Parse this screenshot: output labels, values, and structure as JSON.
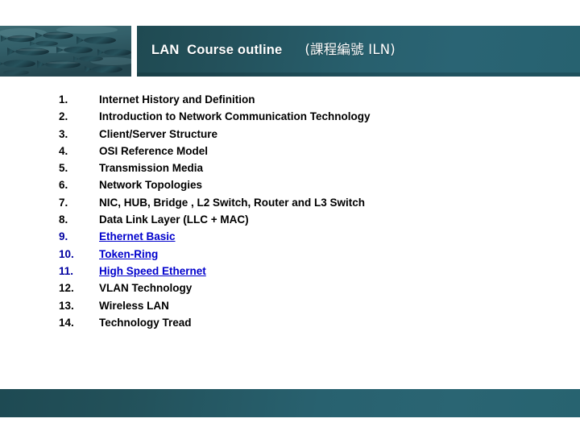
{
  "header": {
    "title_main": "LAN  Course outline",
    "title_code": "(課程編號 ILN)",
    "photo_alt": "underwater-school-of-fish"
  },
  "outline": {
    "items": [
      {
        "number": "1.",
        "label": "Internet History and Definition",
        "link": false
      },
      {
        "number": "2.",
        "label": "Introduction to Network Communication Technology",
        "link": false
      },
      {
        "number": "3.",
        "label": "Client/Server Structure",
        "link": false
      },
      {
        "number": "4.",
        "label": "OSI Reference Model",
        "link": false
      },
      {
        "number": "5.",
        "label": "Transmission Media",
        "link": false
      },
      {
        "number": "6.",
        "label": "Network Topologies",
        "link": false
      },
      {
        "number": "7.",
        "label": "NIC, HUB, Bridge , L2 Switch, Router and L3 Switch",
        "link": false
      },
      {
        "number": "8.",
        "label": "Data Link Layer (LLC + MAC)",
        "link": false
      },
      {
        "number": "9.",
        "label": "Ethernet Basic",
        "link": true
      },
      {
        "number": "10.",
        "label": "Token-Ring",
        "link": true
      },
      {
        "number": "11.",
        "label": "High Speed Ethernet",
        "link": true
      },
      {
        "number": "12.",
        "label": "VLAN Technology",
        "link": false
      },
      {
        "number": "13.",
        "label": "Wireless LAN",
        "link": false
      },
      {
        "number": "14.",
        "label": "Technology Tread",
        "link": false
      }
    ]
  },
  "colors": {
    "band_dark": "#1f4a52",
    "band_light": "#2a6474",
    "link_text": "#0000cc",
    "link_number": "#0000a0",
    "body_text": "#000000",
    "title_text": "#ffffff"
  }
}
